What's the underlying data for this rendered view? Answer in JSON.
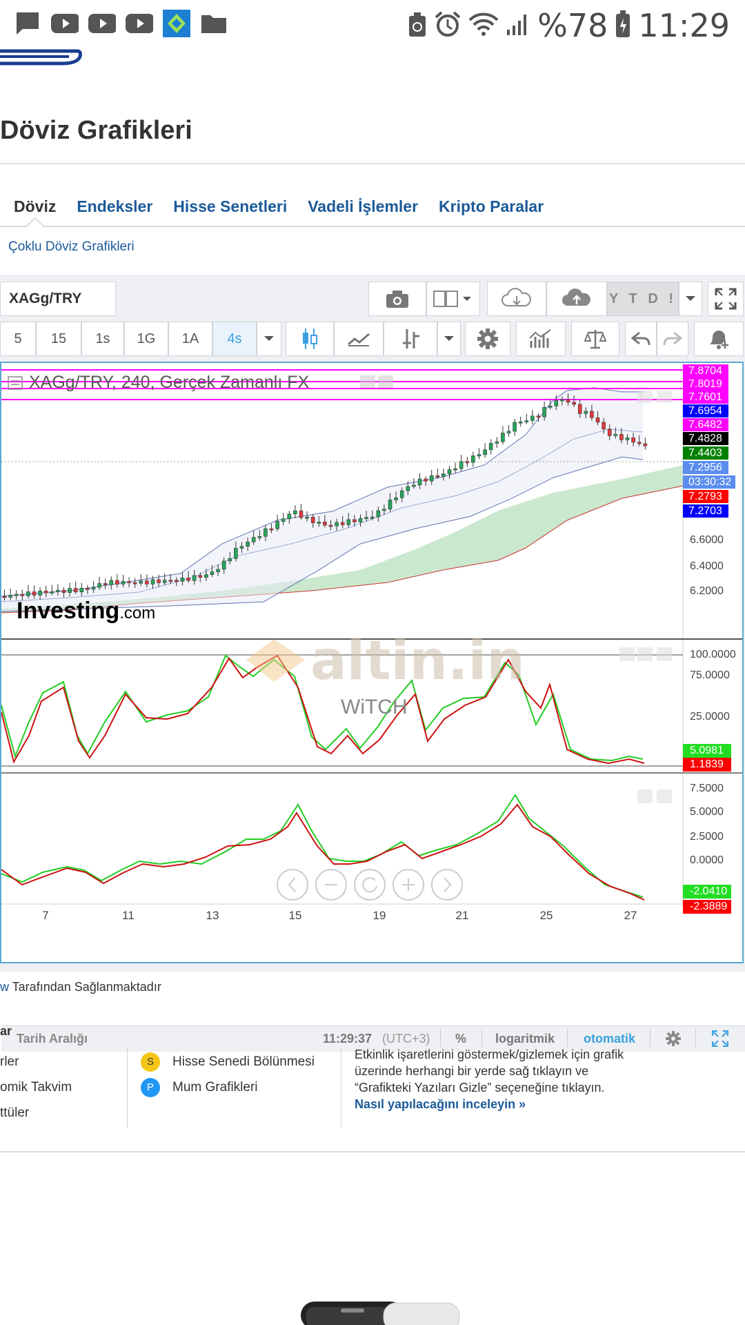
{
  "status_bar": {
    "battery": "%78",
    "time": "11:29"
  },
  "page": {
    "title": "Döviz Grafikleri",
    "tabs": [
      "Döviz",
      "Endeksler",
      "Hisse Senetleri",
      "Vadeli İşlemler",
      "Kripto Paralar"
    ],
    "active_tab": "Döviz",
    "sublink": "Çoklu Döviz Grafikleri"
  },
  "toolbar": {
    "symbol": "XAGg/TRY",
    "range_button": "Y T D !",
    "intervals": [
      "5",
      "15",
      "1s",
      "1G",
      "1A",
      "4s"
    ],
    "active_interval": "4s"
  },
  "chart": {
    "legend": "XAGg/TRY, 240, Gerçek Zamanlı FX",
    "watermark_brand": "Investing",
    "watermark_suffix": ".com",
    "watermark2": "altin.in",
    "watermark3": "WiTCH",
    "price_labels": [
      {
        "text": "7.8704",
        "bg": "#ff00ff",
        "fg": "#ffffff"
      },
      {
        "text": "7.8019",
        "bg": "#ff00ff",
        "fg": "#ffffff"
      },
      {
        "text": "7.7601",
        "bg": "#ff00ff",
        "fg": "#ffffff"
      },
      {
        "text": "7.6954",
        "bg": "#0000ff",
        "fg": "#ffffff"
      },
      {
        "text": "7.6482",
        "bg": "#ff00ff",
        "fg": "#ffffff"
      },
      {
        "text": "7.4828",
        "bg": "#000000",
        "fg": "#ffffff"
      },
      {
        "text": "7.4403",
        "bg": "#008000",
        "fg": "#ffffff"
      },
      {
        "text": "7.2956",
        "bg": "#5b8def",
        "fg": "#ffffff"
      },
      {
        "text": "03:30:32",
        "bg": "#5b8def",
        "fg": "#ffffff"
      },
      {
        "text": "7.2793",
        "bg": "#ff0000",
        "fg": "#ffffff"
      },
      {
        "text": "7.2703",
        "bg": "#0000ff",
        "fg": "#ffffff"
      }
    ],
    "price_axis": [
      "6.6000",
      "6.4000",
      "6.2000"
    ],
    "osc1_axis": [
      "100.0000",
      "75.0000",
      "25.0000"
    ],
    "osc1_labels": [
      {
        "text": "5.0981",
        "bg": "#22dd22",
        "fg": "#ffffff"
      },
      {
        "text": "1.1839",
        "bg": "#ff0000",
        "fg": "#ffffff"
      }
    ],
    "osc2_axis": [
      "7.5000",
      "5.0000",
      "2.5000",
      "0.0000"
    ],
    "osc2_labels": [
      {
        "text": "-2.0410",
        "bg": "#22dd22",
        "fg": "#ffffff"
      },
      {
        "text": "-2.3889",
        "bg": "#ff0000",
        "fg": "#ffffff"
      }
    ],
    "x_ticks": [
      "7",
      "11",
      "13",
      "15",
      "19",
      "21",
      "25",
      "27"
    ]
  },
  "chart_footer": {
    "range": "Tarih Aralığı",
    "time": "11:29:37",
    "tz": "(UTC+3)",
    "percent": "%",
    "log": "logaritmik",
    "auto": "otomatik"
  },
  "provided_by": {
    "link": "w",
    "text": " Tarafından Sağlanmaktadır"
  },
  "events": {
    "heading": "ar",
    "left_items": [
      "rler",
      "omik Takvim",
      "ttüler"
    ],
    "markers": [
      {
        "letter": "S",
        "label": "Hisse Senedi Bölünmesi",
        "color": "#f5c518",
        "fg": "#333333"
      },
      {
        "letter": "P",
        "label": "Mum Grafikleri",
        "color": "#2196f3",
        "fg": "#ffffff"
      }
    ],
    "help_text": "Etkinlik işaretlerini göstermek/gizlemek için grafik üzerinde herhangi bir yerde sağ tıklayın ve “Grafikteki Yazıları Gizle” seçeneğine tıklayın.",
    "help_link": "Nasıl yapılacağını inceleyin »"
  },
  "colors": {
    "link": "#1b5a99",
    "up_candle": "#26a65b",
    "down_candle": "#e0393e",
    "k_line": "#22cc22",
    "d_line": "#cc1111",
    "cloud": "#b8e0bc"
  },
  "icons": [
    "message-icon",
    "youtube-icon",
    "app-icon",
    "folder-icon",
    "recycle-icon",
    "alarm-icon",
    "wifi-icon",
    "signal-icon",
    "battery-icon",
    "camera-icon",
    "layout-icon",
    "cloud-download-icon",
    "cloud-upload-icon",
    "fullscreen-icon",
    "candles-icon",
    "line-chart-icon",
    "drawing-icon",
    "gear-icon",
    "indicators-icon",
    "compare-icon",
    "undo-icon",
    "redo-icon",
    "alert-icon"
  ]
}
